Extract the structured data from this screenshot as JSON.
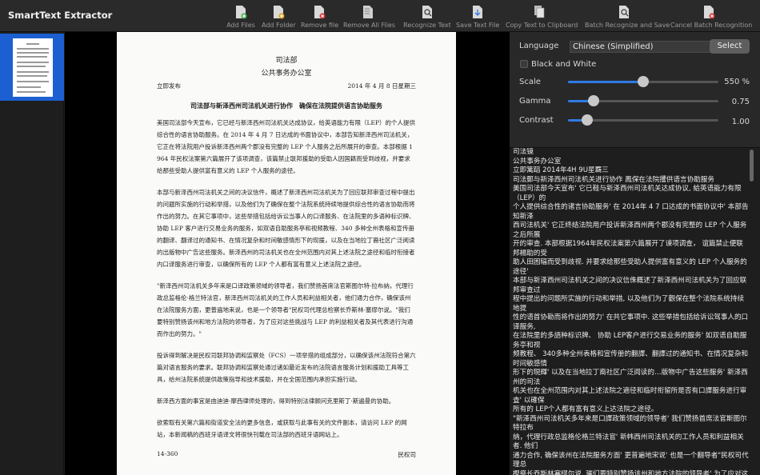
{
  "app": {
    "title": "SmartText Extractor"
  },
  "toolbar": {
    "add_files": "Add Files",
    "add_folder": "Add Folder",
    "remove_file": "Remove file",
    "remove_all": "Remove All Files",
    "recognize": "Recognize Text",
    "save": "Save Text File",
    "copy": "Copy Text to Clipboard",
    "batch_save": "Batch Recognize and Save",
    "cancel_batch": "Cancel Batch Recognition"
  },
  "document": {
    "org": "司法部",
    "office": "公共事务办公室",
    "release": "立即发布",
    "date": "2014 年 4 月 8 日星期三",
    "title": "司法部与新泽西州司法机关进行协作　确保在法院提供语言协助服务",
    "paragraphs": [
      "美国司法部今天宣布，它已经与新泽西州司法机关达成协议，给英语能力有限（LEP）的个人提供综合性的语言协助服务。在 2014 年 4 月 7 日达成的书面协议中，本部告知新泽西州司法机关，它正在将法院用户投诉新泽西州两个郡没有完整的 LEP 个人服务之后所展开的审查。本部根据 1964 年民权法案第六篇展开了该项调查，该篇禁止联邦援助的受助人因国籍而受到歧视，并要求给那些受助人提供富有意义的 LEP 个人服务的途径。",
      "本部与新泽西州司法机关之间的决议信件，概述了新泽西州司法机关为了回应联邦审查过程中提出的问题所实施的行动和举措，以及他们为了确保在整个法院系统持续地提供综合性的语言协助而将作出的努力。在其它事项中，这些举措包括给诉讼当事人的口译服务、在法院里的多语种标识牌、协助 LEP 客户进行交易业务的服务，如双语自助服务亭和视频教程、340 多种全州表格和宣传册的翻译、翻译过的通知书、在情况复杂和时间敏感情形下的现援，以及在当地拉丁裔社区广泛阅读的出版物中广告这些服务。新泽西州的司法机关也在全州范围内对其上述法院之途径和临时衔接者内口译服务进行审查，以确保所有的 LEP 个人都有富有意义上述法院之途径。",
      "\"新泽西州司法机关多年来是口译政策领域的领导者，我们赞扬首席法官斯图尔特·拉布纳，代理行政总监格伦·格兰特法官，新泽西州司法机关的工作人员和利益相关者，他们通力合作，确保该州在法院服务方面，更普遍地来说，也是一个领导者\"民权司代理总检察长乔斯林·塞缪尔说。\"我们要特别赞扬该州和地方法院的领导者，为了应对这些挑战与 LEP 的利益相关者及其代表进行沟通而作出的努力。\"",
      "投诉得到解决是民权司联邦协调和监察处（FCS）一项举措的组成部分，以确保该州法院符合第六篇对语言服务的要求。联邦协调和监察处通过诸如最近发布的法院语言服务计划和援助工具等工具，给州法院系统提供政策指导和技术援助，并在全国范围内承担实施行动。",
      "新泽西方面的事宜是由迪迪·摩西律师处理的，得到特别法律顾问克里斯丁·斯遍曼的协助。",
      "欲索取有关第六篇和街道安全法的更多信息，或获取与此事有关的文件副本，请访问 LEP 的网站，本新闻稿的西班牙语译文将很快刊载在司法部的西班牙语网站上。"
    ],
    "footer_left": "14-360",
    "footer_right": "民权司"
  },
  "settings": {
    "language_label": "Language",
    "language_value": "Chinese (Simplified)",
    "select_label": "Select",
    "bw_label": "Black and White",
    "bw_checked": false,
    "scale_label": "Scale",
    "scale_value": "550 %",
    "scale_fraction": 0.5,
    "gamma_label": "Gamma",
    "gamma_value": "0.75",
    "gamma_fraction": 0.17,
    "contrast_label": "Contrast",
    "contrast_value": "1.00",
    "contrast_fraction": 0.13
  },
  "ocr_lines": [
    "司法镜",
    "公共事务办公室",
    "立即篱蹈 2014年4H 9U星覉三",
    "司法郵与新泽西州司法机关进行协作 鳳保在法院攫供语言协助服务",
    "美国司法部今天宣布' 它已鞋与新泽西州司法机关达成协议, 給英语能力有限（LEP）的",
    "个人提供综合性的诸言协助服务' 在 2014年 4 7 口达成的书面协议中' 本部告知新泽",
    "西司法机关' 它正终结法院用户投诉新泽西州两个郡没有完整的 LEP 个人服务之后所展",
    "开的审查. 本部根据1964年民权法案第六篇展开了谏项调查，  谊篇禁止便联邦楊助的受",
    "助人田困辐而受到歧视. 并要求给那些受助人提供富有意义的 LEP 个人服务的途径'",
    "本部与新泽西州司法机关之间的决议信侏概述了新泽西州司法机关为了回应联邦审查过",
    "程中提出的问题所实施的行动和举措, 以及他们为了觀保在整个法院系统持续地提",
    "性的语首协勘而将作出的努力' 在共它事项中. 这些举措包括给诉讼驾事人的口译服务,",
    "在法院里的多語种标识牌、 协助 LEP客户进行交易业务的服务' 如双语自助服务亭和视",
    "频教程、 340多种全州表格和宣传册的翻譯、翻譯过的通知书、在情况复杂和时间敏感情",
    "形下的現輝' 以及在当地拉丁裔社区广泛阅读的…版物中广告这些服务' 新泽西州的司法",
    "机关也在全州范围内对其上述法院之適径和临时衔留所是否有口譯服务进行审査' 以確保",
    "所有的 LEP个人都有富有意义上达法院之途径。",
    "\"新泽西州司法机关多年来是口譯政策领域的领导者' 我们赞扬首席法官斯图尔特拉布",
    "纳，代理行政总监格伦格兰特法官' 新帏西州司法机关的工作人员和利益相关者. 他们",
    "通力合作, 确保该州在法院服务方面' 更普遍地宋说' 也是一个翻导者\"民权司代理总",
    "樫祭长乔斯林塞缪尔说. 璀们要特别赞扬该州和地方法院的领导者' 为了应对这些挑",
    "战与 LEP的利益相关者及其代表进行沟通而作出的努力。\""
  ]
}
